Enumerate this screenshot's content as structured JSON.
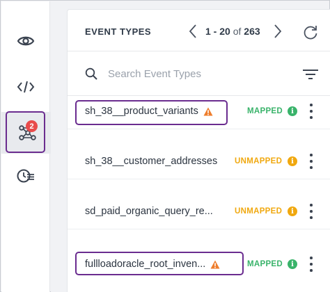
{
  "rail": {
    "items": [
      {
        "icon": "eye-icon"
      },
      {
        "icon": "code-icon"
      },
      {
        "icon": "mapping-graph-icon",
        "badge": "2",
        "active": true
      },
      {
        "icon": "history-list-icon"
      }
    ]
  },
  "panel": {
    "title": "EVENT TYPES",
    "pager": {
      "range": "1 - 20",
      "of_label": "of",
      "total": "263"
    },
    "search": {
      "placeholder": "Search Event Types",
      "value": ""
    }
  },
  "events": [
    {
      "name": "sh_38__product_variants",
      "warning": true,
      "status": "MAPPED",
      "status_kind": "mapped"
    },
    {
      "name": "sh_38__customer_addresses",
      "warning": false,
      "status": "UNMAPPED",
      "status_kind": "unmapped"
    },
    {
      "name": "sd_paid_organic_query_re...",
      "warning": false,
      "status": "UNMAPPED",
      "status_kind": "unmapped"
    },
    {
      "name": "fullloadoracle_root_inven...",
      "warning": true,
      "status": "MAPPED",
      "status_kind": "mapped"
    }
  ],
  "colors": {
    "highlight": "#6a2c8f",
    "mapped": "#39b36a",
    "unmapped": "#f0a80f",
    "warning": "#ee7d2c",
    "badge": "#e84b4b"
  }
}
